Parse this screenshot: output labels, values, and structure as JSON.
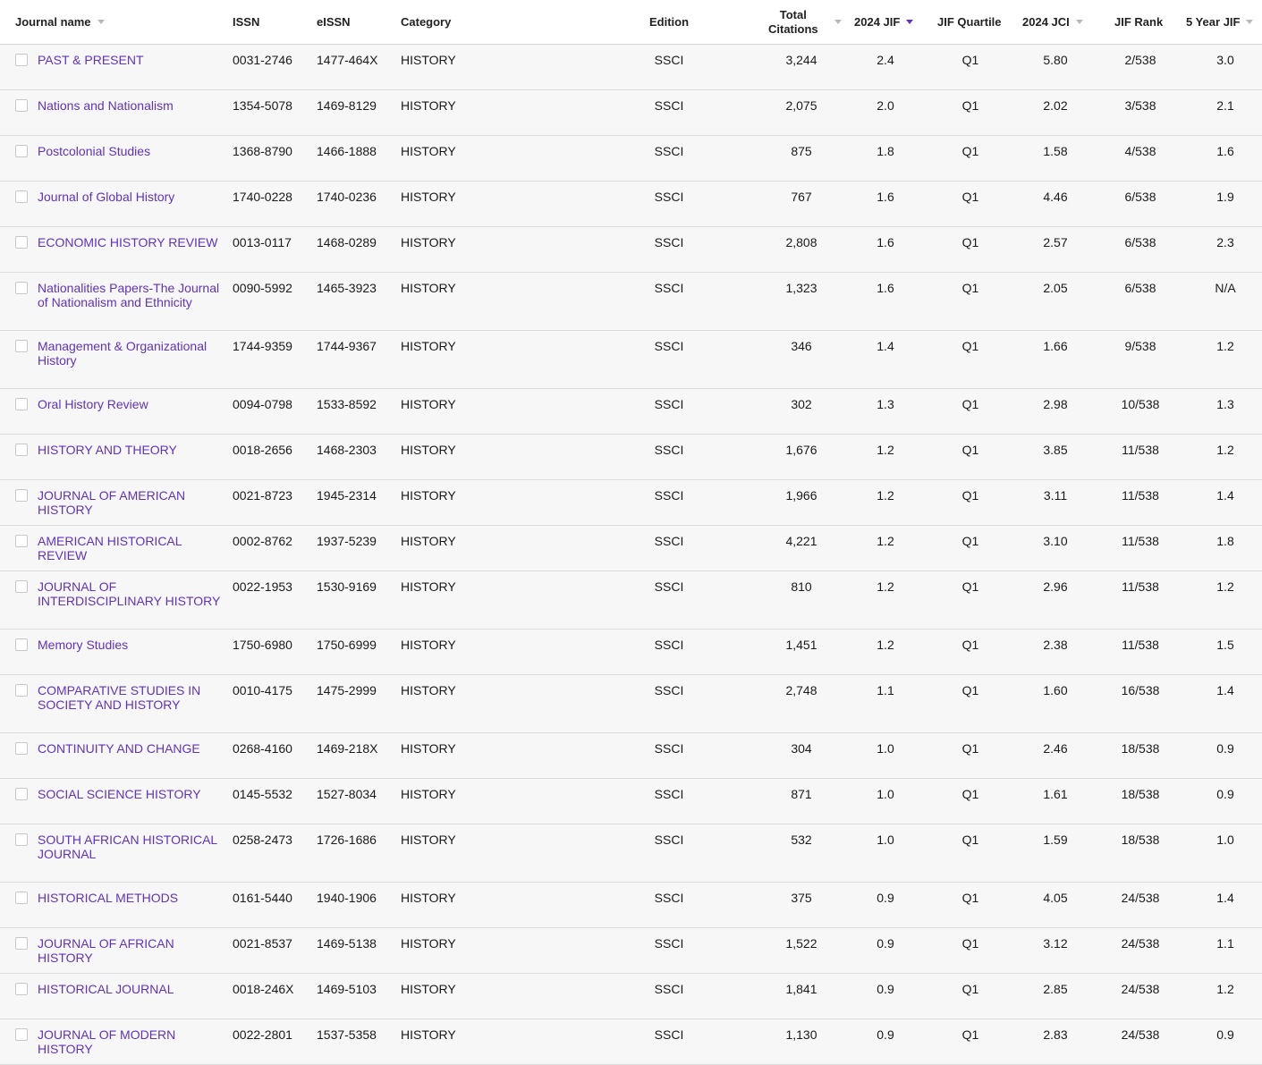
{
  "columns": {
    "journal_name": "Journal name",
    "issn": "ISSN",
    "eissn": "eISSN",
    "category": "Category",
    "edition": "Edition",
    "total_citations_line1": "Total",
    "total_citations_line2": "Citations",
    "jif": "2024 JIF",
    "jif_quartile": "JIF Quartile",
    "jci": "2024 JCI",
    "jif_rank": "JIF Rank",
    "five_year_jif": "5 Year JIF"
  },
  "colors": {
    "accent": "#5e33bf",
    "sort_inactive": "#b8b8b8"
  },
  "sort": {
    "active_column": "2024 JIF",
    "direction": "descending"
  },
  "rows": [
    {
      "name": "PAST & PRESENT",
      "issn": "0031-2746",
      "eissn": "1477-464X",
      "category": "HISTORY",
      "edition": "SSCI",
      "citations": "3,244",
      "jif": "2.4",
      "quartile": "Q1",
      "jci": "5.80",
      "rank": "2/538",
      "five": "3.0"
    },
    {
      "name": "Nations and Nationalism",
      "issn": "1354-5078",
      "eissn": "1469-8129",
      "category": "HISTORY",
      "edition": "SSCI",
      "citations": "2,075",
      "jif": "2.0",
      "quartile": "Q1",
      "jci": "2.02",
      "rank": "3/538",
      "five": "2.1"
    },
    {
      "name": "Postcolonial Studies",
      "issn": "1368-8790",
      "eissn": "1466-1888",
      "category": "HISTORY",
      "edition": "SSCI",
      "citations": "875",
      "jif": "1.8",
      "quartile": "Q1",
      "jci": "1.58",
      "rank": "4/538",
      "five": "1.6"
    },
    {
      "name": "Journal of Global History",
      "issn": "1740-0228",
      "eissn": "1740-0236",
      "category": "HISTORY",
      "edition": "SSCI",
      "citations": "767",
      "jif": "1.6",
      "quartile": "Q1",
      "jci": "4.46",
      "rank": "6/538",
      "five": "1.9"
    },
    {
      "name": "ECONOMIC HISTORY REVIEW",
      "issn": "0013-0117",
      "eissn": "1468-0289",
      "category": "HISTORY",
      "edition": "SSCI",
      "citations": "2,808",
      "jif": "1.6",
      "quartile": "Q1",
      "jci": "2.57",
      "rank": "6/538",
      "five": "2.3"
    },
    {
      "name": "Nationalities Papers-The Journal of Nationalism and Ethnicity",
      "issn": "0090-5992",
      "eissn": "1465-3923",
      "category": "HISTORY",
      "edition": "SSCI",
      "citations": "1,323",
      "jif": "1.6",
      "quartile": "Q1",
      "jci": "2.05",
      "rank": "6/538",
      "five": "N/A"
    },
    {
      "name": "Management & Organizational History",
      "issn": "1744-9359",
      "eissn": "1744-9367",
      "category": "HISTORY",
      "edition": "SSCI",
      "citations": "346",
      "jif": "1.4",
      "quartile": "Q1",
      "jci": "1.66",
      "rank": "9/538",
      "five": "1.2"
    },
    {
      "name": "Oral History Review",
      "issn": "0094-0798",
      "eissn": "1533-8592",
      "category": "HISTORY",
      "edition": "SSCI",
      "citations": "302",
      "jif": "1.3",
      "quartile": "Q1",
      "jci": "2.98",
      "rank": "10/538",
      "five": "1.3"
    },
    {
      "name": "HISTORY AND THEORY",
      "issn": "0018-2656",
      "eissn": "1468-2303",
      "category": "HISTORY",
      "edition": "SSCI",
      "citations": "1,676",
      "jif": "1.2",
      "quartile": "Q1",
      "jci": "3.85",
      "rank": "11/538",
      "five": "1.2"
    },
    {
      "name": "JOURNAL OF AMERICAN HISTORY",
      "issn": "0021-8723",
      "eissn": "1945-2314",
      "category": "HISTORY",
      "edition": "SSCI",
      "citations": "1,966",
      "jif": "1.2",
      "quartile": "Q1",
      "jci": "3.11",
      "rank": "11/538",
      "five": "1.4"
    },
    {
      "name": "AMERICAN HISTORICAL REVIEW",
      "issn": "0002-8762",
      "eissn": "1937-5239",
      "category": "HISTORY",
      "edition": "SSCI",
      "citations": "4,221",
      "jif": "1.2",
      "quartile": "Q1",
      "jci": "3.10",
      "rank": "11/538",
      "five": "1.8"
    },
    {
      "name": "JOURNAL OF INTERDISCIPLINARY HISTORY",
      "issn": "0022-1953",
      "eissn": "1530-9169",
      "category": "HISTORY",
      "edition": "SSCI",
      "citations": "810",
      "jif": "1.2",
      "quartile": "Q1",
      "jci": "2.96",
      "rank": "11/538",
      "five": "1.2"
    },
    {
      "name": "Memory Studies",
      "issn": "1750-6980",
      "eissn": "1750-6999",
      "category": "HISTORY",
      "edition": "SSCI",
      "citations": "1,451",
      "jif": "1.2",
      "quartile": "Q1",
      "jci": "2.38",
      "rank": "11/538",
      "five": "1.5"
    },
    {
      "name": "COMPARATIVE STUDIES IN SOCIETY AND HISTORY",
      "issn": "0010-4175",
      "eissn": "1475-2999",
      "category": "HISTORY",
      "edition": "SSCI",
      "citations": "2,748",
      "jif": "1.1",
      "quartile": "Q1",
      "jci": "1.60",
      "rank": "16/538",
      "five": "1.4"
    },
    {
      "name": "CONTINUITY AND CHANGE",
      "issn": "0268-4160",
      "eissn": "1469-218X",
      "category": "HISTORY",
      "edition": "SSCI",
      "citations": "304",
      "jif": "1.0",
      "quartile": "Q1",
      "jci": "2.46",
      "rank": "18/538",
      "five": "0.9"
    },
    {
      "name": "SOCIAL SCIENCE HISTORY",
      "issn": "0145-5532",
      "eissn": "1527-8034",
      "category": "HISTORY",
      "edition": "SSCI",
      "citations": "871",
      "jif": "1.0",
      "quartile": "Q1",
      "jci": "1.61",
      "rank": "18/538",
      "five": "0.9"
    },
    {
      "name": "SOUTH AFRICAN HISTORICAL JOURNAL",
      "issn": "0258-2473",
      "eissn": "1726-1686",
      "category": "HISTORY",
      "edition": "SSCI",
      "citations": "532",
      "jif": "1.0",
      "quartile": "Q1",
      "jci": "1.59",
      "rank": "18/538",
      "five": "1.0"
    },
    {
      "name": "HISTORICAL METHODS",
      "issn": "0161-5440",
      "eissn": "1940-1906",
      "category": "HISTORY",
      "edition": "SSCI",
      "citations": "375",
      "jif": "0.9",
      "quartile": "Q1",
      "jci": "4.05",
      "rank": "24/538",
      "five": "1.4"
    },
    {
      "name": "JOURNAL OF AFRICAN HISTORY",
      "issn": "0021-8537",
      "eissn": "1469-5138",
      "category": "HISTORY",
      "edition": "SSCI",
      "citations": "1,522",
      "jif": "0.9",
      "quartile": "Q1",
      "jci": "3.12",
      "rank": "24/538",
      "five": "1.1"
    },
    {
      "name": "HISTORICAL JOURNAL",
      "issn": "0018-246X",
      "eissn": "1469-5103",
      "category": "HISTORY",
      "edition": "SSCI",
      "citations": "1,841",
      "jif": "0.9",
      "quartile": "Q1",
      "jci": "2.85",
      "rank": "24/538",
      "five": "1.2"
    },
    {
      "name": "JOURNAL OF MODERN HISTORY",
      "issn": "0022-2801",
      "eissn": "1537-5358",
      "category": "HISTORY",
      "edition": "SSCI",
      "citations": "1,130",
      "jif": "0.9",
      "quartile": "Q1",
      "jci": "2.83",
      "rank": "24/538",
      "five": "0.9"
    }
  ]
}
